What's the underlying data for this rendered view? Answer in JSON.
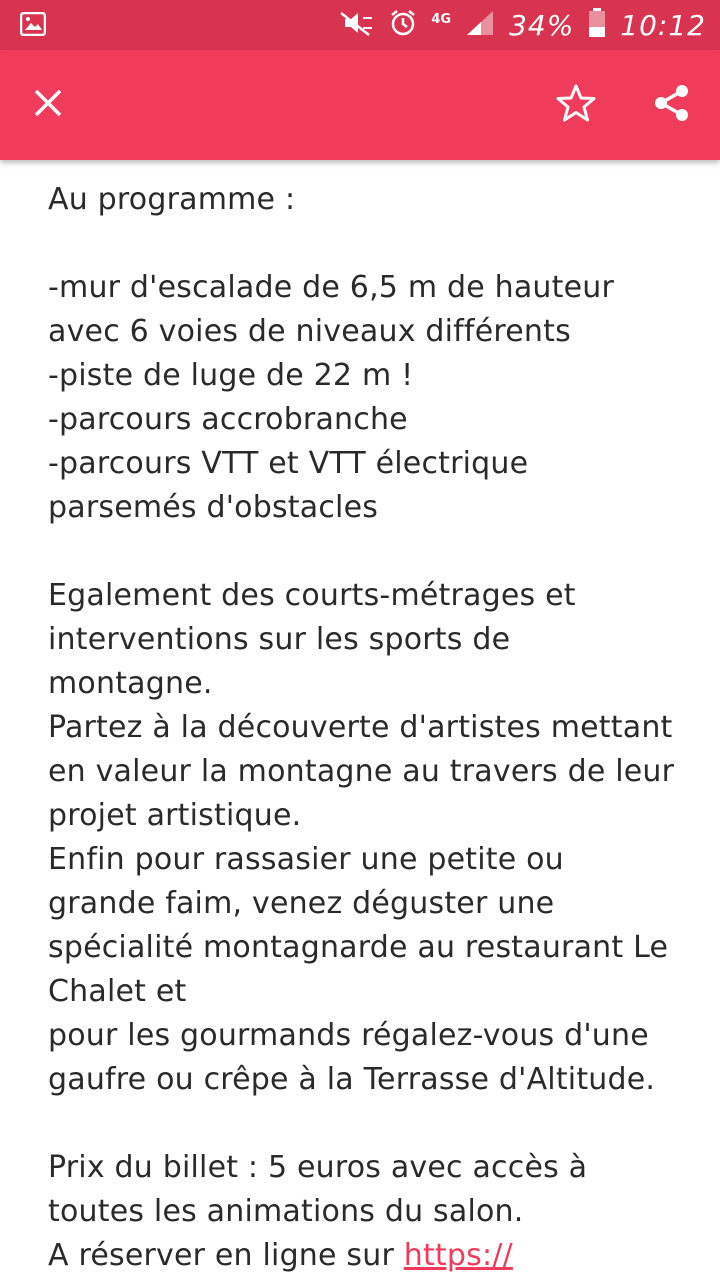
{
  "status_bar": {
    "network": "4G",
    "battery": "34%",
    "time": "10:12",
    "icons": [
      "gallery-icon",
      "mute-icon",
      "alarm-icon",
      "signal-icon",
      "battery-icon"
    ]
  },
  "app_bar": {
    "close_icon": "close-icon",
    "favorite_icon": "star-icon",
    "share_icon": "share-icon",
    "background_color": "#f03c5a",
    "status_color": "#d9344f"
  },
  "content": {
    "lines": [
      "Au programme :",
      "",
      "-mur d'escalade de 6,5 m de hauteur",
      "avec 6 voies de niveaux différents",
      "-piste de luge de 22 m !",
      "-parcours accrobranche",
      "-parcours VTT et VTT électrique",
      "parsemés d'obstacles",
      "",
      "Egalement des courts-métrages et",
      "interventions sur les sports de",
      "montagne.",
      "Partez à la découverte d'artistes mettant",
      "en valeur la montagne au travers de leur",
      "projet artistique.",
      "Enfin pour rassasier une petite ou",
      "grande faim, venez déguster une",
      "spécialité montagnarde au restaurant Le",
      "Chalet et",
      "pour les gourmands régalez-vous d'une",
      "gaufre ou crêpe à la Terrasse d'Altitude.",
      "",
      "Prix du billet : 5 euros avec accès à",
      "toutes les animations du salon."
    ],
    "last_line_prefix": "A réserver en ligne sur ",
    "link_text": "https://"
  }
}
